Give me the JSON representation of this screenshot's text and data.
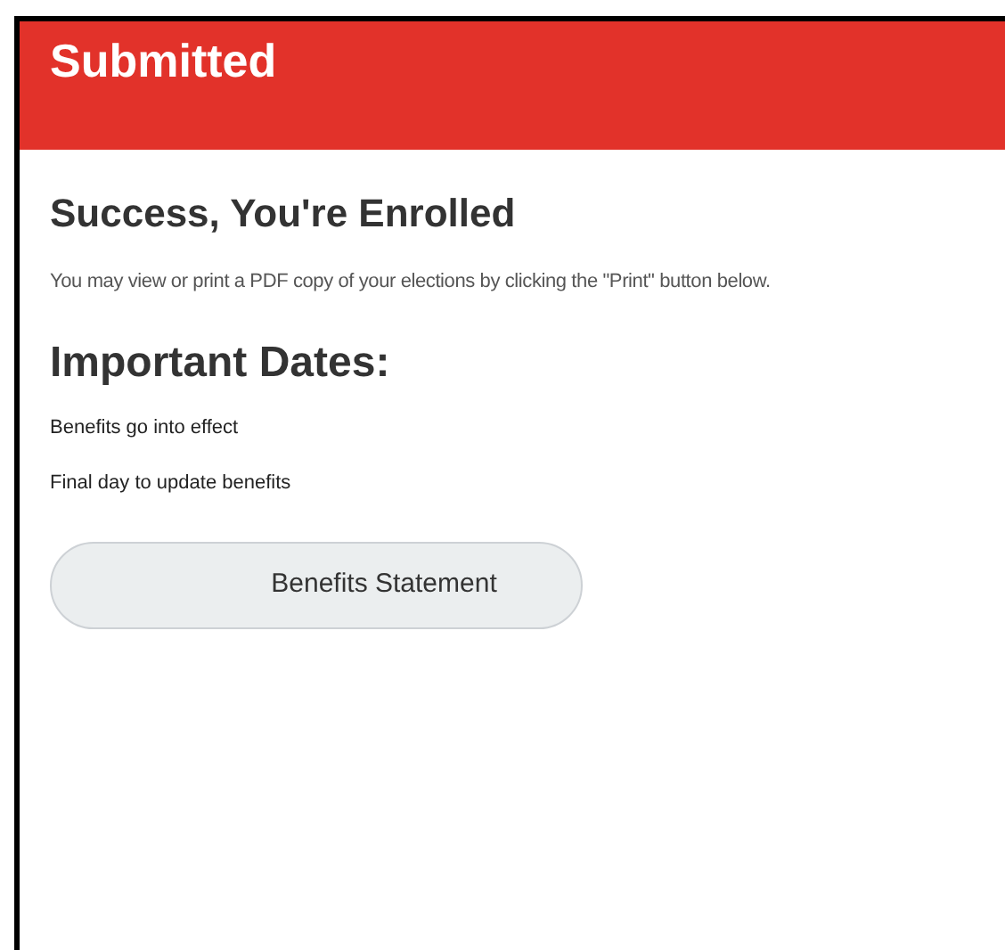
{
  "header": {
    "title": "Submitted"
  },
  "heading": "Success, You're Enrolled",
  "message": "You may view or print a PDF copy of your elections by clicking the \"Print\" button below.",
  "dates_heading": "Important Dates:",
  "dates": [
    "Benefits go into effect",
    "Final day to update benefits"
  ],
  "button": "Benefits Statement"
}
